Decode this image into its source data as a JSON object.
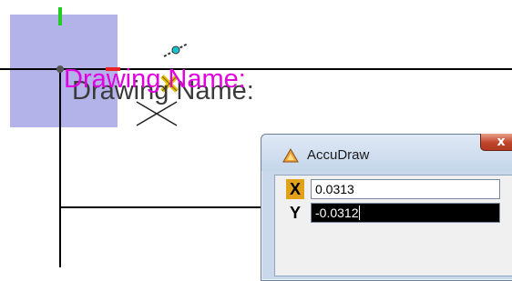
{
  "drawing": {
    "label": "Drawing Name:",
    "label_ghost": "Drawing Name:"
  },
  "accudraw": {
    "title": "AccuDraw",
    "close_label": "x",
    "x_label": "X",
    "x_value": "0.0313",
    "y_label": "Y",
    "y_value": "-0.0312"
  },
  "colors": {
    "highlight_box": "#b3b3ea",
    "frame_line": "#000000",
    "label_magenta": "#e000e0",
    "x_axis_green": "#22cc22",
    "y_axis_red": "#ee2222",
    "accent_yellow": "#e8c000"
  },
  "icons": [
    "accudraw-icon",
    "close-icon",
    "cursor-crosshair-icon",
    "snap-marker-icon",
    "tentative-point-icon"
  ]
}
